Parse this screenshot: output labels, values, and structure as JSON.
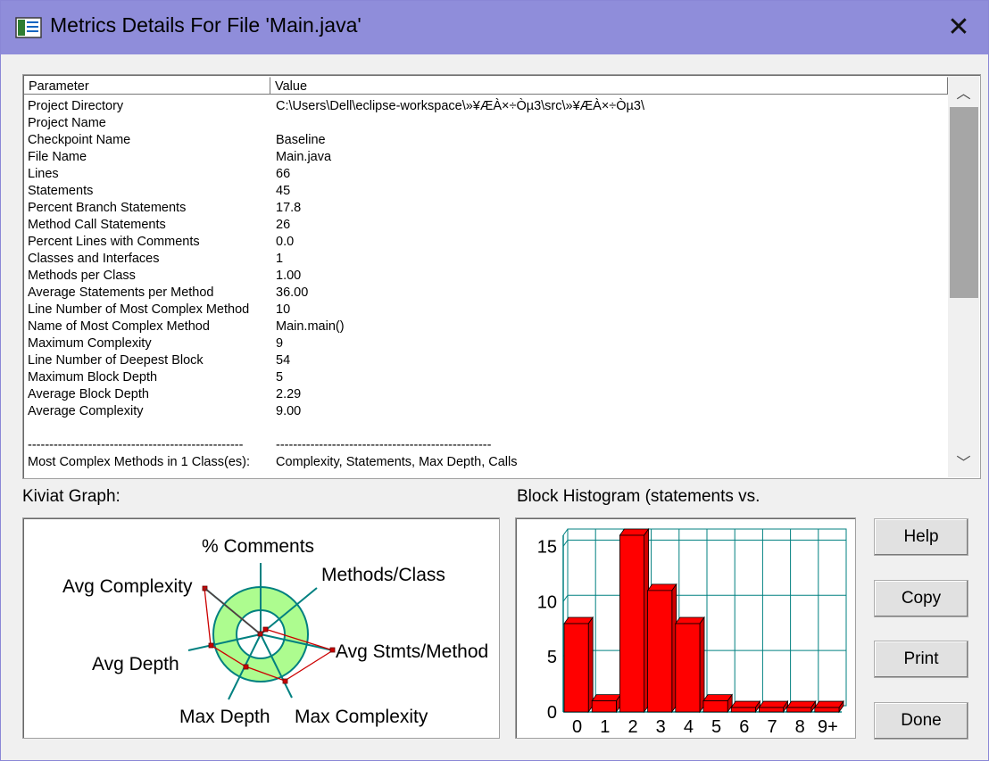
{
  "window": {
    "title": "Metrics Details For File 'Main.java'",
    "close_glyph": "✕"
  },
  "table": {
    "headers": {
      "parameter": "Parameter",
      "value": "Value"
    },
    "rows": [
      {
        "param": "Project Directory",
        "value": "C:\\Users\\Dell\\eclipse-workspace\\»¥ÆÀ×÷Òµ3\\src\\»¥ÆÀ×÷Òµ3\\"
      },
      {
        "param": "Project Name",
        "value": ""
      },
      {
        "param": "Checkpoint Name",
        "value": "Baseline"
      },
      {
        "param": "File Name",
        "value": "Main.java"
      },
      {
        "param": "Lines",
        "value": "66"
      },
      {
        "param": "Statements",
        "value": "45"
      },
      {
        "param": "Percent Branch Statements",
        "value": "17.8"
      },
      {
        "param": "Method Call Statements",
        "value": "26"
      },
      {
        "param": "Percent Lines with Comments",
        "value": "0.0"
      },
      {
        "param": "Classes and Interfaces",
        "value": "1"
      },
      {
        "param": "Methods per Class",
        "value": "1.00"
      },
      {
        "param": "Average Statements per Method",
        "value": "36.00"
      },
      {
        "param": "Line Number of Most Complex Method",
        "value": "10"
      },
      {
        "param": "Name of Most Complex Method",
        "value": "Main.main()"
      },
      {
        "param": "Maximum Complexity",
        "value": "9"
      },
      {
        "param": "Line Number of Deepest Block",
        "value": "54"
      },
      {
        "param": "Maximum Block Depth",
        "value": "5"
      },
      {
        "param": "Average Block Depth",
        "value": "2.29"
      },
      {
        "param": "Average Complexity",
        "value": "9.00"
      },
      {
        "param": "",
        "value": ""
      },
      {
        "param": "--------------------------------------------------",
        "value": "--------------------------------------------------"
      },
      {
        "param": "Most Complex Methods in 1 Class(es):",
        "value": "Complexity, Statements, Max Depth, Calls"
      }
    ]
  },
  "scrollbar": {
    "up_glyph": "︿",
    "down_glyph": "﹀"
  },
  "kiviat": {
    "label": "Kiviat Graph:",
    "axes": [
      "% Comments",
      "Methods/Class",
      "Avg Stmts/Method",
      "Max Complexity",
      "Max Depth",
      "Avg Depth",
      "Avg Complexity"
    ]
  },
  "histogram": {
    "label": "Block Histogram (statements vs.",
    "y_ticks": [
      "15",
      "10",
      "5",
      "0"
    ]
  },
  "chart_data": {
    "type": "bar",
    "title": "Block Histogram (statements vs.",
    "categories": [
      "0",
      "1",
      "2",
      "3",
      "4",
      "5",
      "6",
      "7",
      "8",
      "9+"
    ],
    "values": [
      8,
      1,
      16,
      11,
      8,
      1,
      0,
      0,
      0,
      0
    ],
    "ylim": [
      0,
      16
    ],
    "y_ticks": [
      0,
      5,
      10,
      15
    ],
    "grid": true,
    "bar_color": "#ff0000"
  },
  "buttons": {
    "help": "Help",
    "copy": "Copy",
    "print": "Print",
    "done": "Done"
  },
  "colors": {
    "titlebar": "#8f8dda",
    "ring_fill": "#adfc8f",
    "ring_stroke": "#008080",
    "bar": "#ff0000",
    "poly": "#ff0000"
  }
}
